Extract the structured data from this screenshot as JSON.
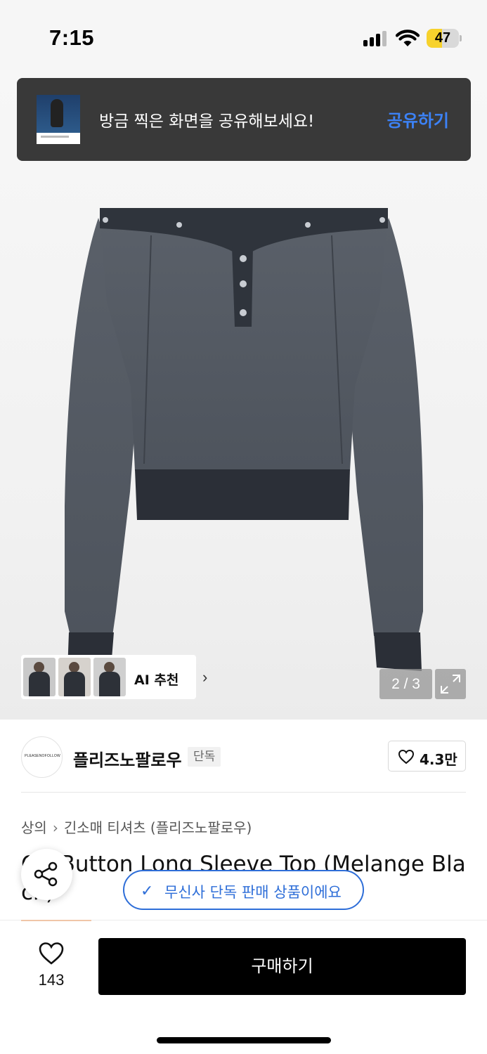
{
  "status_bar": {
    "time": "7:15",
    "battery_level": 47,
    "battery_text": "47",
    "battery_color": "#f7d22c"
  },
  "share_toast": {
    "message": "방금 찍은 화면을 공유해보세요!",
    "action_label": "공유하기",
    "action_color": "#3c82f6"
  },
  "product_image": {
    "counter": "2 / 3",
    "ai_recommend_label": "AI 추천",
    "ai_thumb_count": 3
  },
  "brand": {
    "name": "플리즈노팔로우",
    "badge": "단독",
    "logo_text": "PLEASENOFOLLOW",
    "likes": "4.3만"
  },
  "breadcrumb": {
    "items": [
      "상의",
      "긴소매 티셔츠 (플리즈노팔로우)"
    ]
  },
  "product": {
    "title": "Off Button Long Sleeve Top (Melange Black)"
  },
  "exclusive_notice": {
    "text": "무신사 단독 판매 상품이에요",
    "color": "#2e6ed8"
  },
  "bottom_bar": {
    "wish_count": "143",
    "buy_label": "구매하기"
  }
}
